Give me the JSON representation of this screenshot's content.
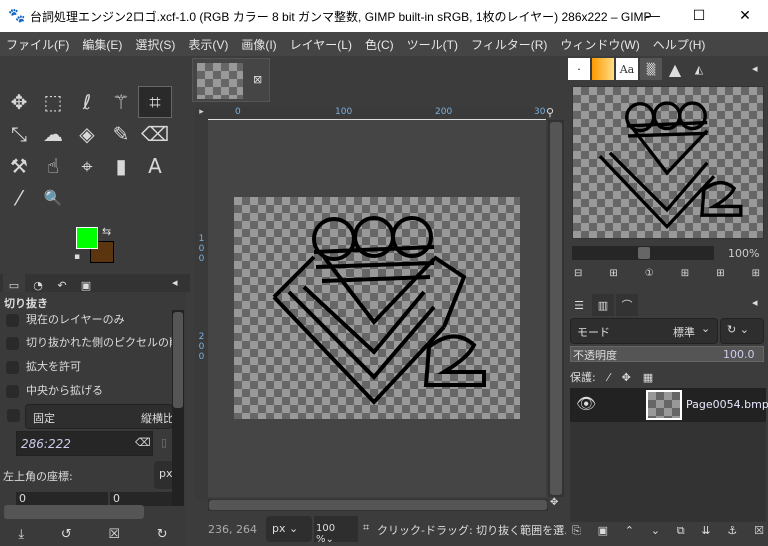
{
  "window": {
    "title": "台詞処理エンジン2ロゴ.xcf-1.0 (RGB カラー 8 bit ガンマ整数, GIMP built-in sRGB, 1枚のレイヤー) 286x222 – GIMP",
    "minimize": "—",
    "maximize": "☐",
    "close": "✕"
  },
  "menu": [
    "ファイル(F)",
    "編集(E)",
    "選択(S)",
    "表示(V)",
    "画像(I)",
    "レイヤー(L)",
    "色(C)",
    "ツール(T)",
    "フィルター(R)",
    "ウィンドウ(W)",
    "ヘルプ(H)"
  ],
  "toolbox": {
    "tools": [
      {
        "name": "move",
        "glyph": "✥"
      },
      {
        "name": "rect-select",
        "glyph": "⬚"
      },
      {
        "name": "lasso",
        "glyph": "ℓ"
      },
      {
        "name": "fuzzy-select",
        "glyph": "⚚"
      },
      {
        "name": "crop",
        "glyph": "⌗"
      },
      {
        "name": "transform",
        "glyph": "⤡"
      },
      {
        "name": "warp",
        "glyph": "☁"
      },
      {
        "name": "bucket-fill",
        "glyph": "◈"
      },
      {
        "name": "paintbrush",
        "glyph": "✎"
      },
      {
        "name": "eraser",
        "glyph": "⌫"
      },
      {
        "name": "clone",
        "glyph": "⚒"
      },
      {
        "name": "smudge",
        "glyph": "☝"
      },
      {
        "name": "paths",
        "glyph": "⌖"
      },
      {
        "name": "color-picker-2",
        "glyph": "▮"
      },
      {
        "name": "text",
        "glyph": "A"
      },
      {
        "name": "color-picker",
        "glyph": "⁄"
      },
      {
        "name": "zoom",
        "glyph": "🔍"
      }
    ],
    "fg_color": "#00ff00",
    "bg_color": "#5a3510"
  },
  "tool_options": {
    "title": "切り抜き",
    "options": [
      "現在のレイヤーのみ",
      "切り抜かれた側のピクセルの削",
      "拡大を許可",
      "中央から拡げる"
    ],
    "fixed_label": "固定",
    "fixed_mode": "縦横比",
    "ratio": "286:222",
    "position_label": "左上角の座標:",
    "unit": "px",
    "pos_x": "0",
    "pos_y": "0"
  },
  "image_tab": {
    "close": "⊠"
  },
  "rulers": {
    "top": [
      "0",
      "100",
      "200",
      "30"
    ],
    "left": [
      "0",
      "1",
      "0",
      "0",
      "2",
      "0",
      "0"
    ]
  },
  "status": {
    "coords": "236, 264",
    "unit": "px",
    "zoom": "100 %",
    "message": "クリック-ドラッグ: 切り抜く範囲を選..."
  },
  "navigation": {
    "zoom": "100%"
  },
  "layers": {
    "mode_label": "モード",
    "mode_value": "標準",
    "opacity_label": "不透明度",
    "opacity": "100.0",
    "lock_label": "保護:",
    "items": [
      {
        "name": "Page0054.bmp",
        "visible": true
      }
    ]
  }
}
